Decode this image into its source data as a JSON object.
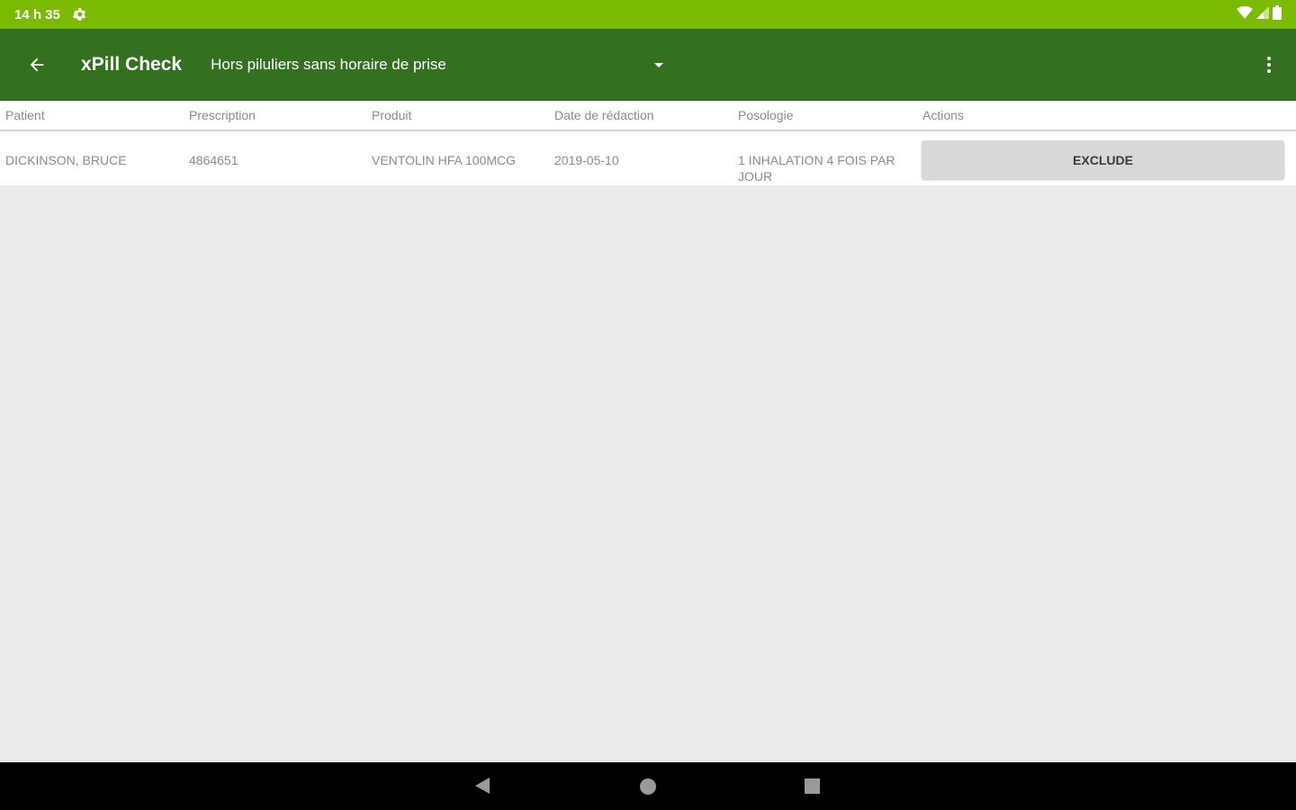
{
  "status_bar": {
    "time": "14 h 35",
    "icons": [
      "settings-icon",
      "wifi-icon",
      "cell-signal-icon",
      "battery-icon"
    ]
  },
  "app_bar": {
    "title": "xPill Check",
    "spinner_value": "Hors piluliers sans horaire de prise",
    "icons": [
      "back-arrow-icon",
      "dropdown-arrow-icon",
      "overflow-menu-icon"
    ]
  },
  "table": {
    "headers": [
      "Patient",
      "Prescription",
      "Produit",
      "Date de rédaction",
      "Posologie",
      "Actions"
    ],
    "rows": [
      {
        "patient": "DICKINSON, BRUCE",
        "prescription": "4864651",
        "produit": "VENTOLIN HFA 100MCG",
        "date": "2019-05-10",
        "posologie": "1 INHALATION 4 FOIS PAR JOUR",
        "action_label": "EXCLUDE"
      }
    ]
  },
  "nav_bar": {
    "icons": [
      "nav-back-icon",
      "nav-home-icon",
      "nav-recents-icon"
    ]
  },
  "colors": {
    "status_bar": "#7aba00",
    "app_bar": "#33701f",
    "background": "#ebebeb",
    "button": "#d8d8d8"
  }
}
